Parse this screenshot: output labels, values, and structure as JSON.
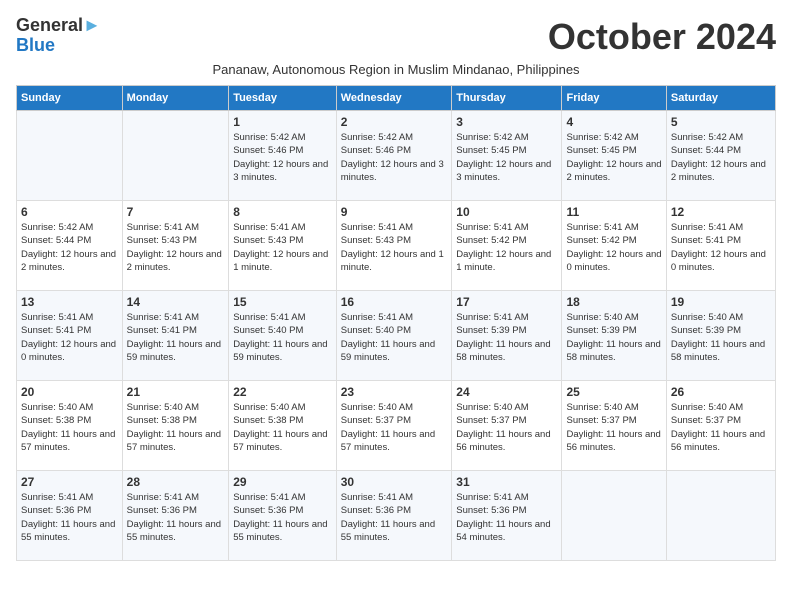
{
  "logo": {
    "line1": "General",
    "line2": "Blue",
    "arrow": "▶"
  },
  "title": "October 2024",
  "subtitle": "Pananaw, Autonomous Region in Muslim Mindanao, Philippines",
  "weekdays": [
    "Sunday",
    "Monday",
    "Tuesday",
    "Wednesday",
    "Thursday",
    "Friday",
    "Saturday"
  ],
  "weeks": [
    [
      {
        "day": "",
        "sunrise": "",
        "sunset": "",
        "daylight": ""
      },
      {
        "day": "",
        "sunrise": "",
        "sunset": "",
        "daylight": ""
      },
      {
        "day": "1",
        "sunrise": "Sunrise: 5:42 AM",
        "sunset": "Sunset: 5:46 PM",
        "daylight": "Daylight: 12 hours and 3 minutes."
      },
      {
        "day": "2",
        "sunrise": "Sunrise: 5:42 AM",
        "sunset": "Sunset: 5:46 PM",
        "daylight": "Daylight: 12 hours and 3 minutes."
      },
      {
        "day": "3",
        "sunrise": "Sunrise: 5:42 AM",
        "sunset": "Sunset: 5:45 PM",
        "daylight": "Daylight: 12 hours and 3 minutes."
      },
      {
        "day": "4",
        "sunrise": "Sunrise: 5:42 AM",
        "sunset": "Sunset: 5:45 PM",
        "daylight": "Daylight: 12 hours and 2 minutes."
      },
      {
        "day": "5",
        "sunrise": "Sunrise: 5:42 AM",
        "sunset": "Sunset: 5:44 PM",
        "daylight": "Daylight: 12 hours and 2 minutes."
      }
    ],
    [
      {
        "day": "6",
        "sunrise": "Sunrise: 5:42 AM",
        "sunset": "Sunset: 5:44 PM",
        "daylight": "Daylight: 12 hours and 2 minutes."
      },
      {
        "day": "7",
        "sunrise": "Sunrise: 5:41 AM",
        "sunset": "Sunset: 5:43 PM",
        "daylight": "Daylight: 12 hours and 2 minutes."
      },
      {
        "day": "8",
        "sunrise": "Sunrise: 5:41 AM",
        "sunset": "Sunset: 5:43 PM",
        "daylight": "Daylight: 12 hours and 1 minute."
      },
      {
        "day": "9",
        "sunrise": "Sunrise: 5:41 AM",
        "sunset": "Sunset: 5:43 PM",
        "daylight": "Daylight: 12 hours and 1 minute."
      },
      {
        "day": "10",
        "sunrise": "Sunrise: 5:41 AM",
        "sunset": "Sunset: 5:42 PM",
        "daylight": "Daylight: 12 hours and 1 minute."
      },
      {
        "day": "11",
        "sunrise": "Sunrise: 5:41 AM",
        "sunset": "Sunset: 5:42 PM",
        "daylight": "Daylight: 12 hours and 0 minutes."
      },
      {
        "day": "12",
        "sunrise": "Sunrise: 5:41 AM",
        "sunset": "Sunset: 5:41 PM",
        "daylight": "Daylight: 12 hours and 0 minutes."
      }
    ],
    [
      {
        "day": "13",
        "sunrise": "Sunrise: 5:41 AM",
        "sunset": "Sunset: 5:41 PM",
        "daylight": "Daylight: 12 hours and 0 minutes."
      },
      {
        "day": "14",
        "sunrise": "Sunrise: 5:41 AM",
        "sunset": "Sunset: 5:41 PM",
        "daylight": "Daylight: 11 hours and 59 minutes."
      },
      {
        "day": "15",
        "sunrise": "Sunrise: 5:41 AM",
        "sunset": "Sunset: 5:40 PM",
        "daylight": "Daylight: 11 hours and 59 minutes."
      },
      {
        "day": "16",
        "sunrise": "Sunrise: 5:41 AM",
        "sunset": "Sunset: 5:40 PM",
        "daylight": "Daylight: 11 hours and 59 minutes."
      },
      {
        "day": "17",
        "sunrise": "Sunrise: 5:41 AM",
        "sunset": "Sunset: 5:39 PM",
        "daylight": "Daylight: 11 hours and 58 minutes."
      },
      {
        "day": "18",
        "sunrise": "Sunrise: 5:40 AM",
        "sunset": "Sunset: 5:39 PM",
        "daylight": "Daylight: 11 hours and 58 minutes."
      },
      {
        "day": "19",
        "sunrise": "Sunrise: 5:40 AM",
        "sunset": "Sunset: 5:39 PM",
        "daylight": "Daylight: 11 hours and 58 minutes."
      }
    ],
    [
      {
        "day": "20",
        "sunrise": "Sunrise: 5:40 AM",
        "sunset": "Sunset: 5:38 PM",
        "daylight": "Daylight: 11 hours and 57 minutes."
      },
      {
        "day": "21",
        "sunrise": "Sunrise: 5:40 AM",
        "sunset": "Sunset: 5:38 PM",
        "daylight": "Daylight: 11 hours and 57 minutes."
      },
      {
        "day": "22",
        "sunrise": "Sunrise: 5:40 AM",
        "sunset": "Sunset: 5:38 PM",
        "daylight": "Daylight: 11 hours and 57 minutes."
      },
      {
        "day": "23",
        "sunrise": "Sunrise: 5:40 AM",
        "sunset": "Sunset: 5:37 PM",
        "daylight": "Daylight: 11 hours and 57 minutes."
      },
      {
        "day": "24",
        "sunrise": "Sunrise: 5:40 AM",
        "sunset": "Sunset: 5:37 PM",
        "daylight": "Daylight: 11 hours and 56 minutes."
      },
      {
        "day": "25",
        "sunrise": "Sunrise: 5:40 AM",
        "sunset": "Sunset: 5:37 PM",
        "daylight": "Daylight: 11 hours and 56 minutes."
      },
      {
        "day": "26",
        "sunrise": "Sunrise: 5:40 AM",
        "sunset": "Sunset: 5:37 PM",
        "daylight": "Daylight: 11 hours and 56 minutes."
      }
    ],
    [
      {
        "day": "27",
        "sunrise": "Sunrise: 5:41 AM",
        "sunset": "Sunset: 5:36 PM",
        "daylight": "Daylight: 11 hours and 55 minutes."
      },
      {
        "day": "28",
        "sunrise": "Sunrise: 5:41 AM",
        "sunset": "Sunset: 5:36 PM",
        "daylight": "Daylight: 11 hours and 55 minutes."
      },
      {
        "day": "29",
        "sunrise": "Sunrise: 5:41 AM",
        "sunset": "Sunset: 5:36 PM",
        "daylight": "Daylight: 11 hours and 55 minutes."
      },
      {
        "day": "30",
        "sunrise": "Sunrise: 5:41 AM",
        "sunset": "Sunset: 5:36 PM",
        "daylight": "Daylight: 11 hours and 55 minutes."
      },
      {
        "day": "31",
        "sunrise": "Sunrise: 5:41 AM",
        "sunset": "Sunset: 5:36 PM",
        "daylight": "Daylight: 11 hours and 54 minutes."
      },
      {
        "day": "",
        "sunrise": "",
        "sunset": "",
        "daylight": ""
      },
      {
        "day": "",
        "sunrise": "",
        "sunset": "",
        "daylight": ""
      }
    ]
  ]
}
